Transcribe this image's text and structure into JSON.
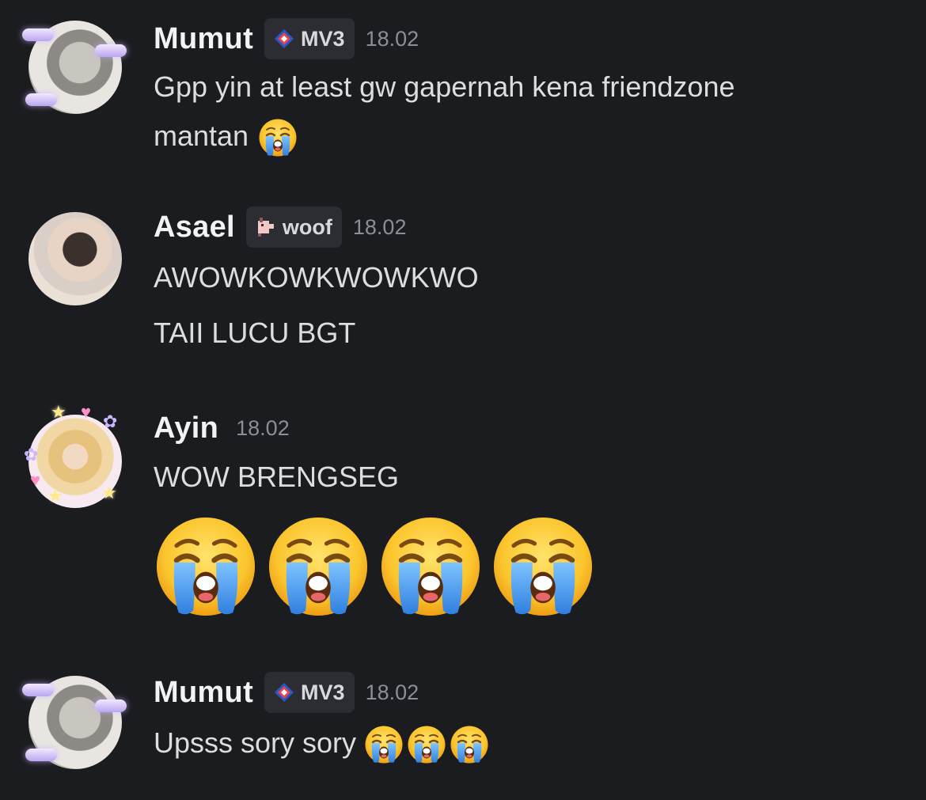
{
  "colors": {
    "background": "#1b1c20",
    "username": "#f2f3f5",
    "message_text": "#dbdee1",
    "timestamp": "#8b8e95",
    "tag_background": "#2c2d33"
  },
  "messages": [
    {
      "username": "Mumut",
      "tag": {
        "icon": "diamond-pixel-icon",
        "label": "MV3"
      },
      "time": "18.02",
      "avatar": "mumut-avatar",
      "lines": [
        "Gpp yin at least gw gapernah kena friendzone",
        "mantan"
      ],
      "trailing_emoji": [
        "loudly-crying-face"
      ]
    },
    {
      "username": "Asael",
      "tag": {
        "icon": "dog-pixel-icon",
        "label": "woof"
      },
      "time": "18.02",
      "avatar": "asael-avatar",
      "lines": [
        "AWOWKOWKWOWKWO",
        "TAII LUCU BGT"
      ]
    },
    {
      "username": "Ayin",
      "time": "18.02",
      "avatar": "ayin-avatar",
      "lines": [
        "WOW BRENGSEG"
      ],
      "big_emoji": [
        "loudly-crying-face",
        "loudly-crying-face",
        "loudly-crying-face",
        "loudly-crying-face"
      ]
    },
    {
      "username": "Mumut",
      "tag": {
        "icon": "diamond-pixel-icon",
        "label": "MV3"
      },
      "time": "18.02",
      "avatar": "mumut-avatar",
      "lines": [
        "Upsss sory sory"
      ],
      "trailing_emoji": [
        "loudly-crying-face",
        "loudly-crying-face",
        "loudly-crying-face"
      ]
    }
  ]
}
